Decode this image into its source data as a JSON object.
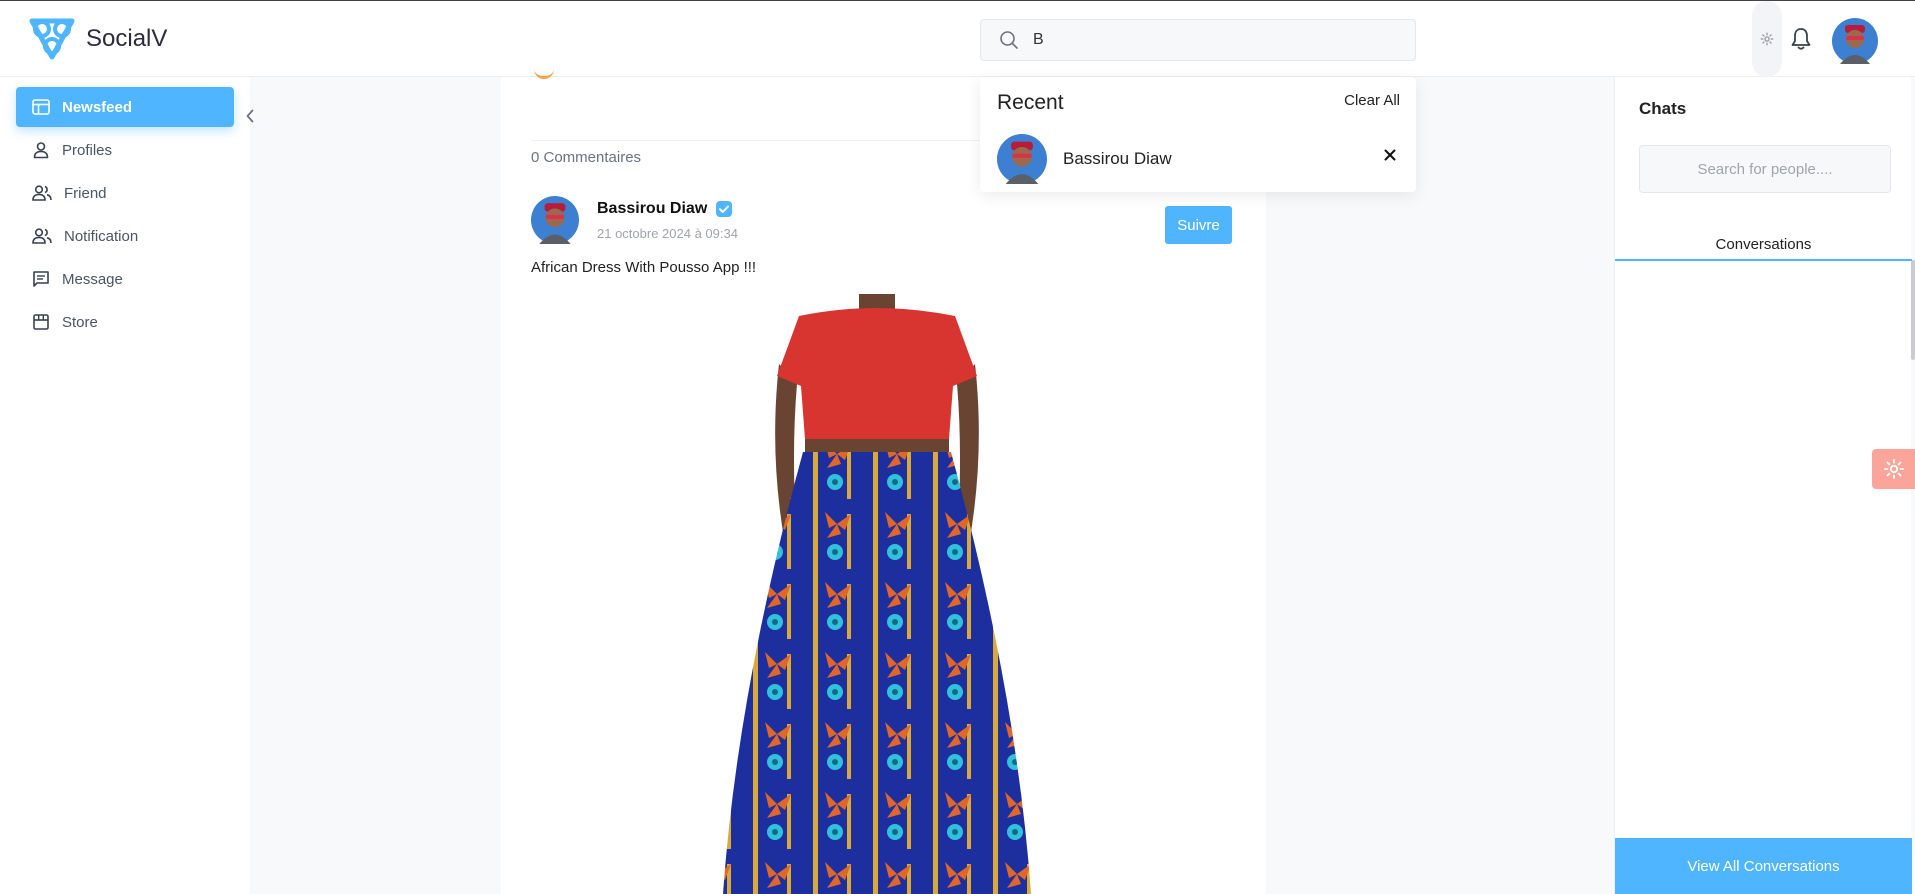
{
  "header": {
    "brand": "SocialV",
    "search": {
      "value": "B",
      "placeholder": ""
    }
  },
  "sidebar": {
    "items": [
      {
        "label": "Newsfeed",
        "icon": "newsfeed-icon",
        "active": true
      },
      {
        "label": "Profiles",
        "icon": "person-icon",
        "active": false
      },
      {
        "label": "Friend",
        "icon": "people-icon",
        "active": false
      },
      {
        "label": "Notification",
        "icon": "people-icon",
        "active": false
      },
      {
        "label": "Message",
        "icon": "message-icon",
        "active": false
      },
      {
        "label": "Store",
        "icon": "store-icon",
        "active": false
      }
    ]
  },
  "post": {
    "comments": "0 Commentaires",
    "author": "Bassirou Diaw",
    "date": "21 octobre 2024 à 09:34",
    "follow_label": "Suivre",
    "text": "African Dress With Pousso App !!!"
  },
  "search_dropdown": {
    "title": "Recent",
    "clear_label": "Clear All",
    "results": [
      {
        "name": "Bassirou Diaw"
      }
    ]
  },
  "chats": {
    "title": "Chats",
    "search_placeholder": "Search for people....",
    "tab_label": "Conversations",
    "view_all_label": "View All Conversations"
  },
  "colors": {
    "accent": "#50b5ff",
    "float_gear_bg": "#fba49a"
  }
}
